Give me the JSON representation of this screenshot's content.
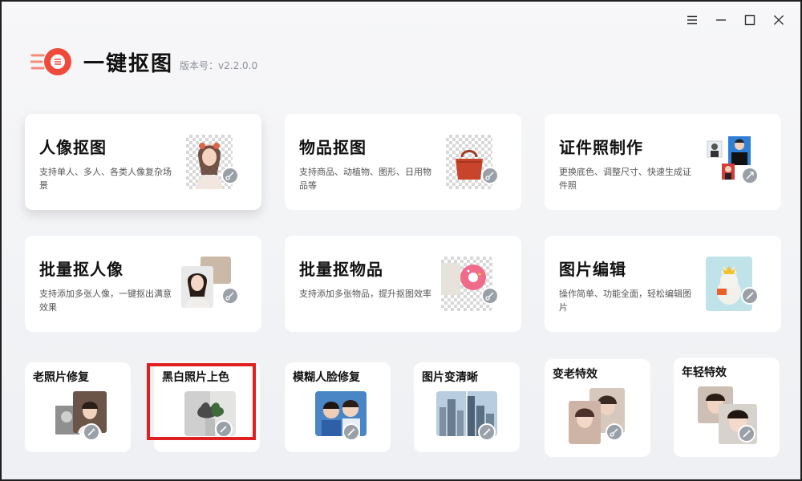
{
  "app": {
    "title": "一键抠图",
    "version": "版本号：v2.2.0.0"
  },
  "window_controls": [
    "menu-icon",
    "minimize-icon",
    "maximize-icon",
    "close-icon"
  ],
  "big_cards": [
    {
      "title": "人像抠图",
      "desc": "支持单人、多人、各类人像复杂场景"
    },
    {
      "title": "物品抠图",
      "desc": "支持商品、动植物、图形、日用物品等"
    },
    {
      "title": "证件照制作",
      "desc": "更换底色、调整尺寸、快速生成证件照"
    },
    {
      "title": "批量抠人像",
      "desc": "支持添加多张人像，一键抠出满意效果"
    },
    {
      "title": "批量抠物品",
      "desc": "支持添加多张物品，提升抠图效率"
    },
    {
      "title": "图片编辑",
      "desc": "操作简单、功能全面，轻松编辑图片"
    }
  ],
  "small_cards": [
    {
      "title": "老照片修复"
    },
    {
      "title": "黑白照片上色"
    },
    {
      "title": "模糊人脸修复"
    },
    {
      "title": "图片变清晰"
    },
    {
      "title": "变老特效"
    },
    {
      "title": "年轻特效"
    }
  ],
  "colors": {
    "brand": "#f04a3a",
    "highlight_box": "#e02020",
    "badge": "#9aa0a8"
  }
}
